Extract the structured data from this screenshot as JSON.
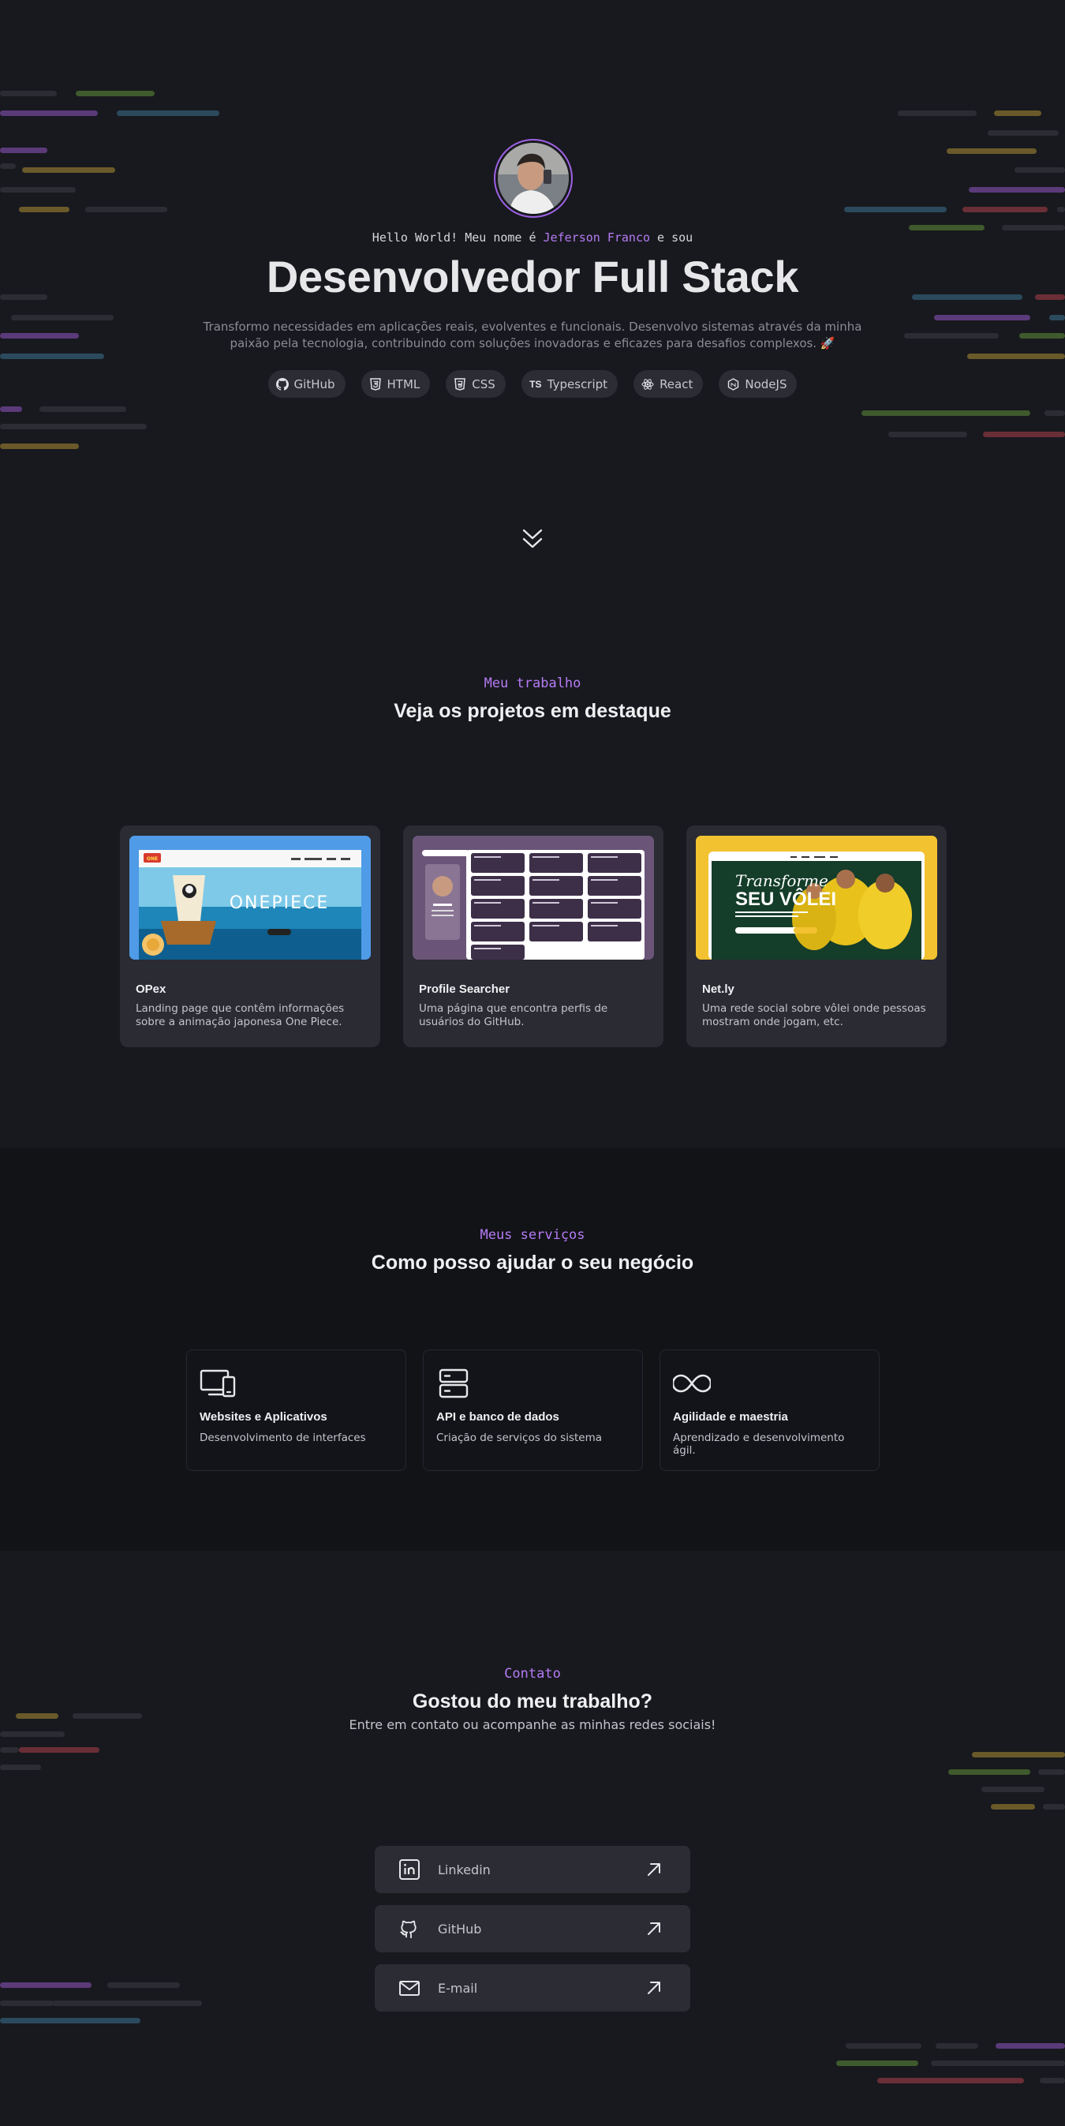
{
  "hero": {
    "hello_prefix": "Hello World! Meu nome é ",
    "name": "Jeferson Franco",
    "hello_suffix": " e sou",
    "title": "Desenvolvedor Full Stack",
    "description": "Transformo necessidades em aplicações reais, evolventes e funcionais. Desenvolvo sistemas através da minha paixão pela tecnologia, contribuindo com soluções inovadoras e eficazes para desafios complexos. 🚀",
    "techs": [
      {
        "label": "GitHub",
        "icon": "github-icon"
      },
      {
        "label": "HTML",
        "icon": "html-icon"
      },
      {
        "label": "CSS",
        "icon": "css-icon"
      },
      {
        "label": "Typescript",
        "icon": "typescript-icon"
      },
      {
        "label": "React",
        "icon": "react-icon"
      },
      {
        "label": "NodeJS",
        "icon": "nodejs-icon"
      }
    ]
  },
  "projects": {
    "label": "Meu trabalho",
    "title": "Veja os projetos em destaque",
    "items": [
      {
        "title": "OPex",
        "description": "Landing page que contêm informações sobre a animação japonesa One Piece.",
        "image_text": "ONEPIECE"
      },
      {
        "title": "Profile Searcher",
        "description": "Uma página que encontra perfis de usuários do GitHub."
      },
      {
        "title": "Net.ly",
        "description": "Uma rede social sobre vôlei onde pessoas mostram onde jogam, etc.",
        "image_text_1": "Transforme",
        "image_text_2": "SEU VÔLEI"
      }
    ]
  },
  "services": {
    "label": "Meus serviços",
    "title": "Como posso ajudar o seu negócio",
    "items": [
      {
        "title": "Websites e Aplicativos",
        "description": "Desenvolvimento de interfaces",
        "icon": "devices-icon"
      },
      {
        "title": "API e banco de dados",
        "description": "Criação de serviços do sistema",
        "icon": "database-icon"
      },
      {
        "title": "Agilidade e maestria",
        "description": "Aprendizado e desenvolvimento ágil.",
        "icon": "infinity-icon"
      }
    ]
  },
  "contact": {
    "label": "Contato",
    "title": "Gostou do meu trabalho?",
    "subtitle": "Entre em contato ou acompanhe as minhas redes sociais!",
    "links": [
      {
        "label": "Linkedin",
        "icon": "linkedin-icon"
      },
      {
        "label": "GitHub",
        "icon": "github-icon"
      },
      {
        "label": "E-mail",
        "icon": "mail-icon"
      }
    ]
  },
  "colors": {
    "background": "#18191e",
    "accent": "#b57bf5",
    "card": "#2a2b33",
    "services_background": "#121317"
  }
}
